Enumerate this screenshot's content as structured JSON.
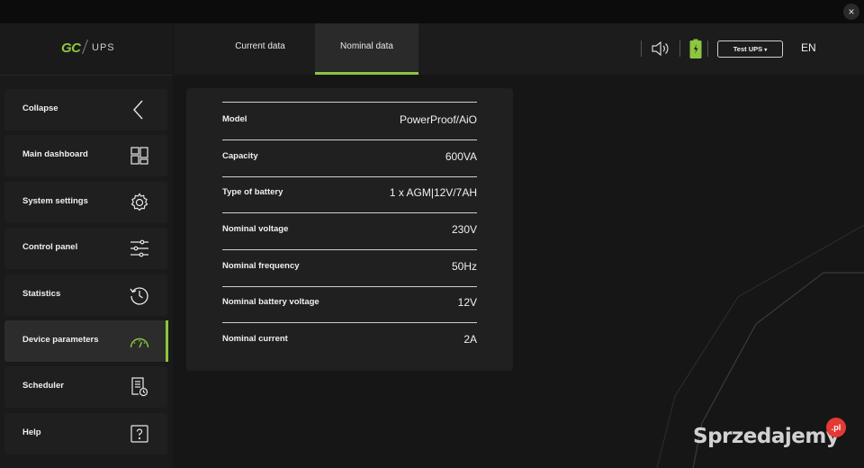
{
  "window": {
    "close_label": "×"
  },
  "logo": {
    "brand": "GC",
    "product": "UPS"
  },
  "sidebar": {
    "items": [
      {
        "label": "Collapse",
        "icon": "chevron-left-icon"
      },
      {
        "label": "Main dashboard",
        "icon": "dashboard-grid-icon"
      },
      {
        "label": "System settings",
        "icon": "gear-icon"
      },
      {
        "label": "Control panel",
        "icon": "sliders-icon"
      },
      {
        "label": "Statistics",
        "icon": "history-clock-icon"
      },
      {
        "label": "Device parameters",
        "icon": "gauge-icon",
        "active": true
      },
      {
        "label": "Scheduler",
        "icon": "schedule-doc-icon"
      },
      {
        "label": "Help",
        "icon": "help-icon"
      }
    ]
  },
  "header": {
    "tabs": [
      {
        "label": "Current data",
        "active": false
      },
      {
        "label": "Nominal data",
        "active": true
      }
    ],
    "device_select": "Test UPS",
    "language": "EN"
  },
  "nominal": {
    "rows": [
      {
        "label": "Model",
        "value": "PowerProof/AiO"
      },
      {
        "label": "Capacity",
        "value": "600VA"
      },
      {
        "label": "Type of battery",
        "value": "1 x AGM|12V/7AH"
      },
      {
        "label": "Nominal voltage",
        "value": "230V"
      },
      {
        "label": "Nominal frequency",
        "value": "50Hz"
      },
      {
        "label": "Nominal battery voltage",
        "value": "12V"
      },
      {
        "label": "Nominal current",
        "value": "2A"
      }
    ]
  },
  "watermark": {
    "text": "Sprzedajemy",
    "suffix": ".pl"
  },
  "colors": {
    "accent": "#8dc63f",
    "background": "#161616",
    "panel": "#202020"
  }
}
